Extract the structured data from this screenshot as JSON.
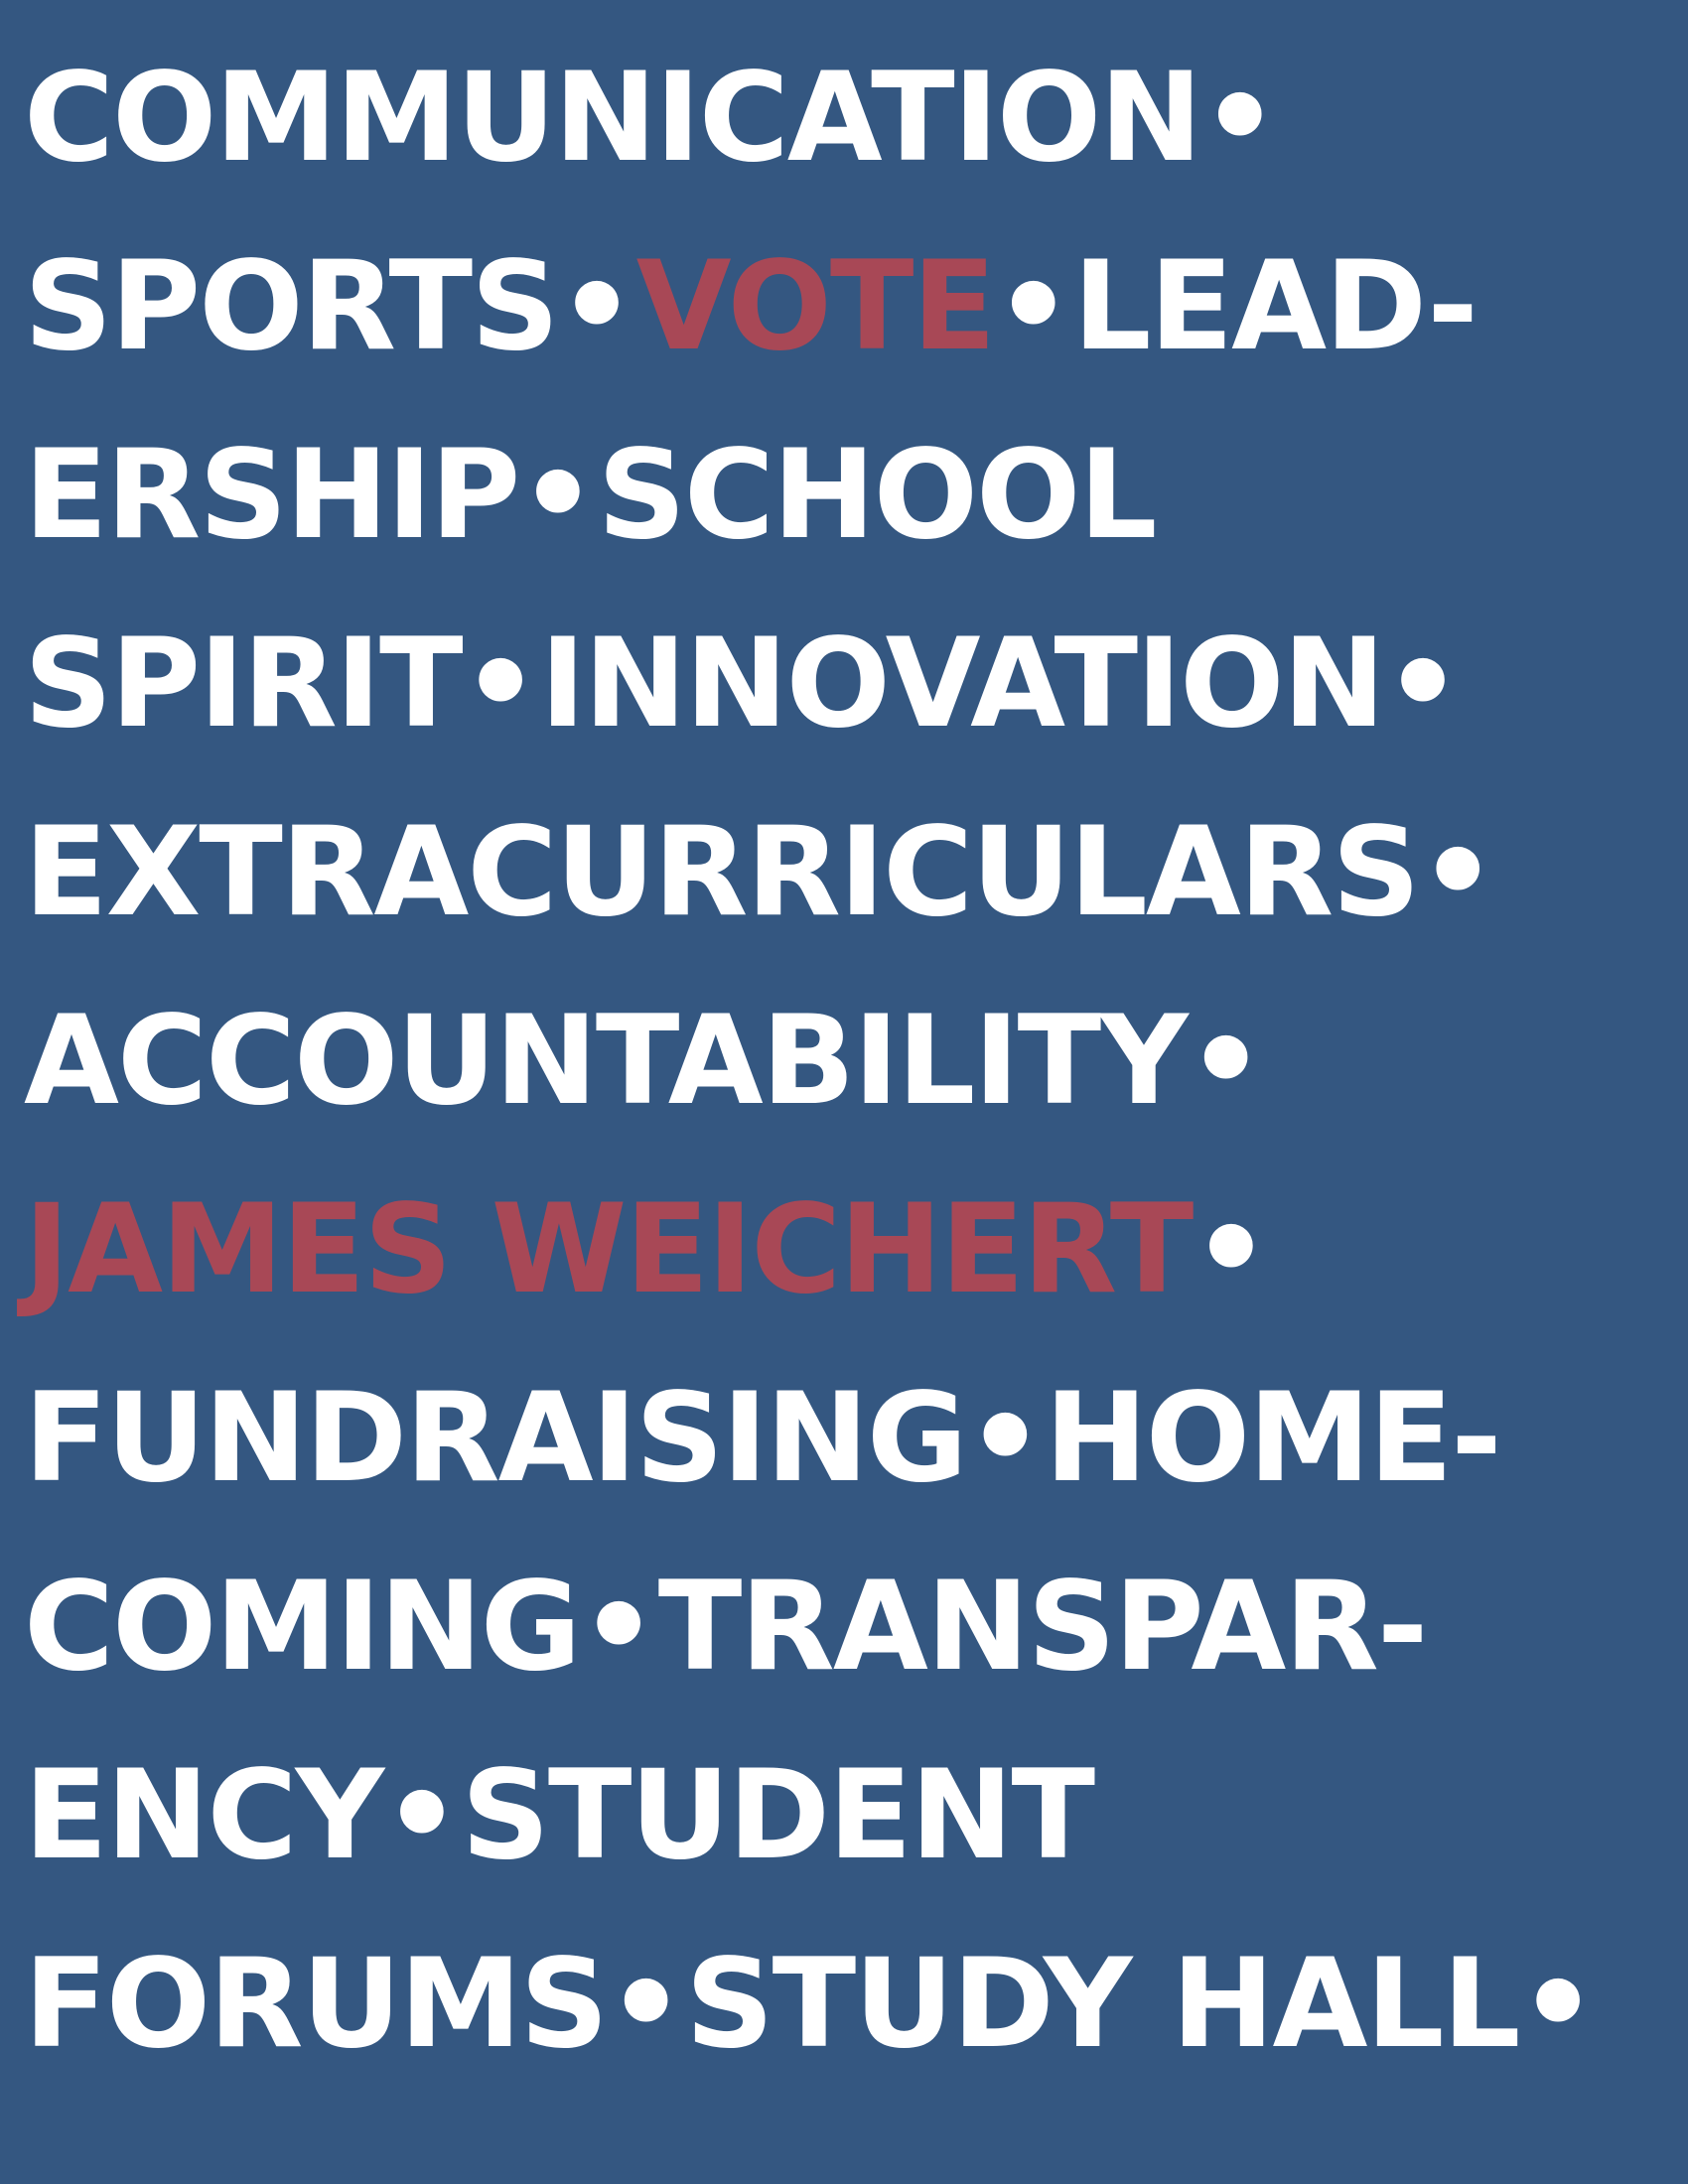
{
  "colors": {
    "background": "#345781",
    "text": "#ffffff",
    "highlight": "#a84856"
  },
  "lines": [
    [
      {
        "text": "COMMUNICATION"
      },
      {
        "text": "•"
      }
    ],
    [
      {
        "text": "SPORTS"
      },
      {
        "text": "•"
      },
      {
        "text": "VOTE",
        "highlight": true
      },
      {
        "text": "•"
      },
      {
        "text": "LEAD-"
      }
    ],
    [
      {
        "text": "ERSHIP"
      },
      {
        "text": "•"
      },
      {
        "text": "SCHOOL"
      }
    ],
    [
      {
        "text": "SPIRIT"
      },
      {
        "text": "•"
      },
      {
        "text": "INNOVATION"
      },
      {
        "text": "•"
      }
    ],
    [
      {
        "text": "EXTRACURRICULARS"
      },
      {
        "text": "•"
      }
    ],
    [
      {
        "text": "ACCOUNTABILITY"
      },
      {
        "text": "•"
      }
    ],
    [
      {
        "text": "JAMES WEICHERT",
        "highlight": true
      },
      {
        "text": "•"
      }
    ],
    [
      {
        "text": "FUNDRAISING"
      },
      {
        "text": "•"
      },
      {
        "text": "HOME-"
      }
    ],
    [
      {
        "text": "COMING"
      },
      {
        "text": "•"
      },
      {
        "text": "TRANSPAR-"
      }
    ],
    [
      {
        "text": "ENCY"
      },
      {
        "text": "•"
      },
      {
        "text": "STUDENT"
      }
    ],
    [
      {
        "text": "FORUMS"
      },
      {
        "text": "•"
      },
      {
        "text": "STUDY HALL"
      },
      {
        "text": "•"
      }
    ]
  ]
}
